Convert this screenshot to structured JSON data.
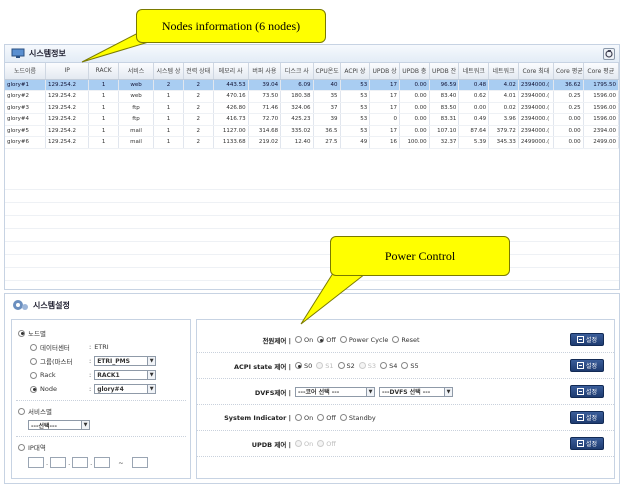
{
  "callouts": {
    "nodes_info": "Nodes information (6 nodes)",
    "power_control": "Power Control"
  },
  "top_panel": {
    "title": "시스템정보",
    "columns": [
      "노드이름",
      "IP",
      "RACK",
      "서비스",
      "시스템 상",
      "전력 상태",
      "메모리 사",
      "버퍼 사용",
      "디스크 사",
      "CPU온도",
      "ACPI 상",
      "UPDB 상",
      "UPDB 충",
      "UPDB 잔",
      "네트워크",
      "네트워크",
      "Core 최대",
      "Core 평균",
      "Core 평균"
    ],
    "rows": [
      [
        "glory#1",
        "129.254.2",
        "1",
        "web",
        "2",
        "2",
        "443.53",
        "39.04",
        "6.09",
        "40",
        "53",
        "17",
        "0.00",
        "96.59",
        "0.48",
        "4.02",
        "2394000.(",
        "36.62",
        "1795.50"
      ],
      [
        "glory#2",
        "129.254.2",
        "1",
        "web",
        "1",
        "2",
        "470.16",
        "73.50",
        "180.38",
        "35",
        "53",
        "17",
        "0.00",
        "83.40",
        "0.62",
        "4.01",
        "2394000.(",
        "0.25",
        "1596.00"
      ],
      [
        "glory#3",
        "129.254.2",
        "1",
        "ftp",
        "1",
        "2",
        "426.80",
        "71.46",
        "324.06",
        "37",
        "53",
        "17",
        "0.00",
        "83.50",
        "0.00",
        "0.02",
        "2394000.(",
        "0.25",
        "1596.00"
      ],
      [
        "glory#4",
        "129.254.2",
        "1",
        "ftp",
        "1",
        "2",
        "416.73",
        "72.70",
        "425.23",
        "39",
        "53",
        "0",
        "0.00",
        "83.31",
        "0.49",
        "3.96",
        "2394000.(",
        "0.00",
        "1596.00"
      ],
      [
        "glory#5",
        "129.254.2",
        "1",
        "mail",
        "1",
        "2",
        "1127.00",
        "314.68",
        "335.02",
        "36.5",
        "53",
        "17",
        "0.00",
        "107.10",
        "87.64",
        "379.72",
        "2394000.(",
        "0.00",
        "2394.00"
      ],
      [
        "glory#6",
        "129.254.2",
        "1",
        "mail",
        "1",
        "2",
        "1133.68",
        "219.02",
        "12.40",
        "27.5",
        "49",
        "16",
        "100.00",
        "32.37",
        "5.39",
        "345.33",
        "2499000.(",
        "0.00",
        "2499.00"
      ]
    ]
  },
  "bottom_panel": {
    "title": "시스템설정",
    "scope": {
      "node_label": "노드별",
      "datacenter_label": "데이터센터",
      "datacenter_value": "ETRI",
      "group_label": "그룹(마스터",
      "group_value": "ETRI_PMS",
      "rack_label": "Rack",
      "rack_value": "RACK1",
      "node_sel_label": "Node",
      "node_sel_value": "glory#4",
      "service_label": "서비스별",
      "service_value": "---선택---",
      "ip_label": "IP대역"
    },
    "controls": [
      {
        "label": "전원제어",
        "options": [
          "On",
          "Off",
          "Power Cycle",
          "Reset"
        ],
        "selected": 1,
        "disabled": [],
        "button": "설정"
      },
      {
        "label": "ACPI state 제어",
        "options": [
          "S0",
          "S1",
          "S2",
          "S3",
          "S4",
          "S5"
        ],
        "selected": 0,
        "disabled": [
          1,
          3
        ],
        "button": "설정"
      },
      {
        "label": "DVFS제어",
        "select1": "---코어 선택 ---",
        "select2": "---DVFS 선택 ---",
        "button": "설정"
      },
      {
        "label": "System Indicator",
        "options": [
          "On",
          "Off",
          "Standby"
        ],
        "selected": -1,
        "disabled": [],
        "button": "설정"
      },
      {
        "label": "UPDB 제어",
        "options": [
          "On",
          "Off"
        ],
        "selected": -1,
        "disabled": [
          0,
          1
        ],
        "button": "설정"
      }
    ]
  }
}
